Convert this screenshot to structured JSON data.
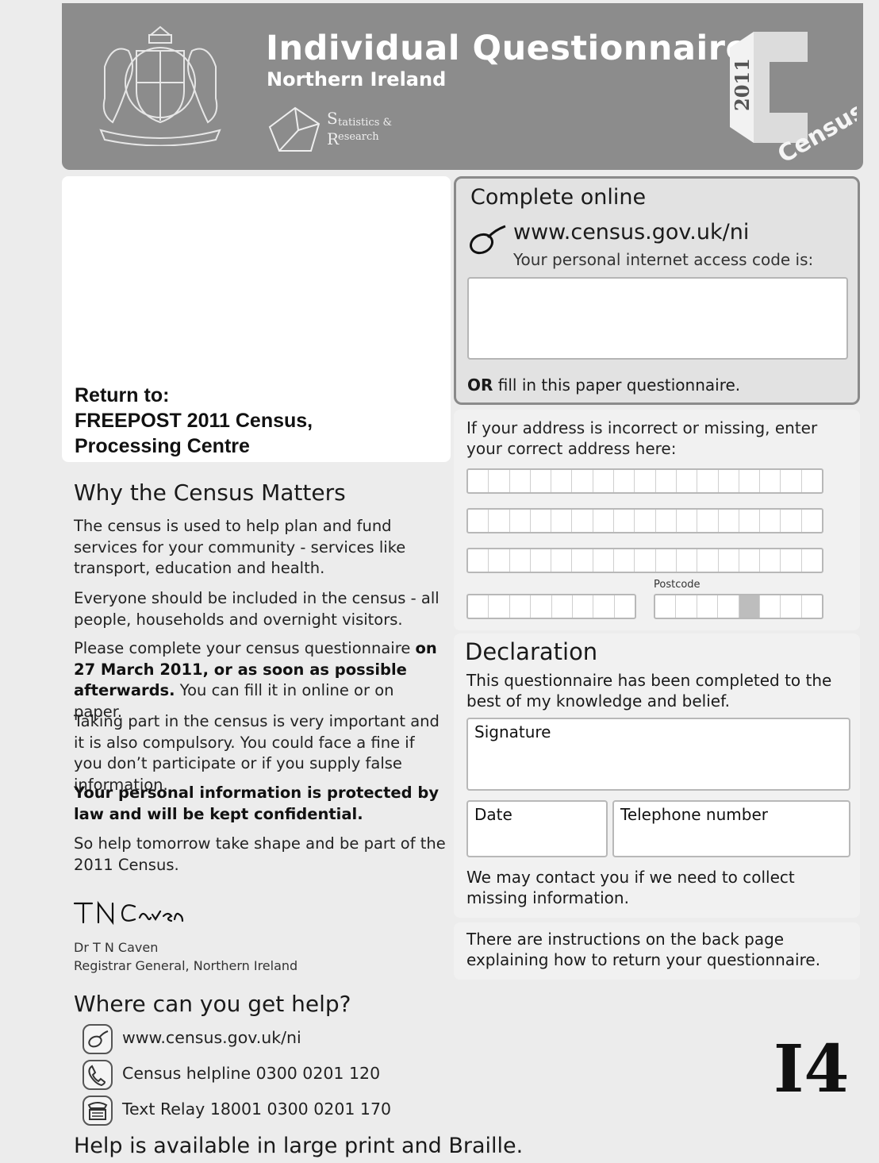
{
  "header": {
    "title": "Individual Questionnaire",
    "subtitle": "Northern Ireland",
    "agency_logo": "Statistics & Research Agency logo",
    "census_logo": {
      "year": "2011",
      "word": "Census"
    }
  },
  "return_address": {
    "line1": "Return to:",
    "line2": "FREEPOST 2011 Census,",
    "line3": "Processing Centre"
  },
  "online": {
    "heading": "Complete online",
    "url": "www.census.gov.uk/ni",
    "access_code_label": "Your personal internet access code is:",
    "alt_prefix": "OR",
    "alt_text": " fill in this paper questionnaire."
  },
  "address": {
    "instructions": "If your address is incorrect or missing, enter your correct address here:",
    "postcode_label": "Postcode"
  },
  "declaration": {
    "heading": "Declaration",
    "text": "This questionnaire has been completed to the best of my knowledge and belief.",
    "signature_label": "Signature",
    "date_label": "Date",
    "telephone_label": "Telephone number",
    "contact_note": "We may contact you if we need to collect missing information."
  },
  "instructions_note": "There are instructions on the back page explaining how to return your questionnaire.",
  "why": {
    "heading": "Why the Census Matters",
    "p1": "The census is used to help plan and fund services for your community - services like transport, education and health.",
    "p2": "Everyone should be included in the census - all people, households and overnight visitors.",
    "p3_normal": "Please complete your census questionnaire",
    "p3_bold": "on 27 March 2011, or as soon as possible afterwards.",
    "p3_tail": " You can fill it in online or on paper.",
    "p4": "Taking part in the census is very important and it is also compulsory. You could face a fine if you don’t participate or if you supply false information.",
    "p5": "Your personal information is protected by law and will be kept confidential.",
    "p6": "So help tomorrow take shape and be part of the 2011 Census.",
    "signature_text": "TN Caven",
    "signatory_name": "Dr T N Caven",
    "signatory_role": "Registrar General, Northern Ireland"
  },
  "help": {
    "heading": "Where can you get help?",
    "items": [
      {
        "icon": "mouse-icon",
        "text": "www.census.gov.uk/ni"
      },
      {
        "icon": "phone-icon",
        "text": "Census helpline 0300 0201 120"
      },
      {
        "icon": "textphone-icon",
        "text": "Text Relay 18001 0300 0201 170"
      }
    ],
    "large_print": "Help is available in large print and Braille."
  },
  "form_code": "I4"
}
